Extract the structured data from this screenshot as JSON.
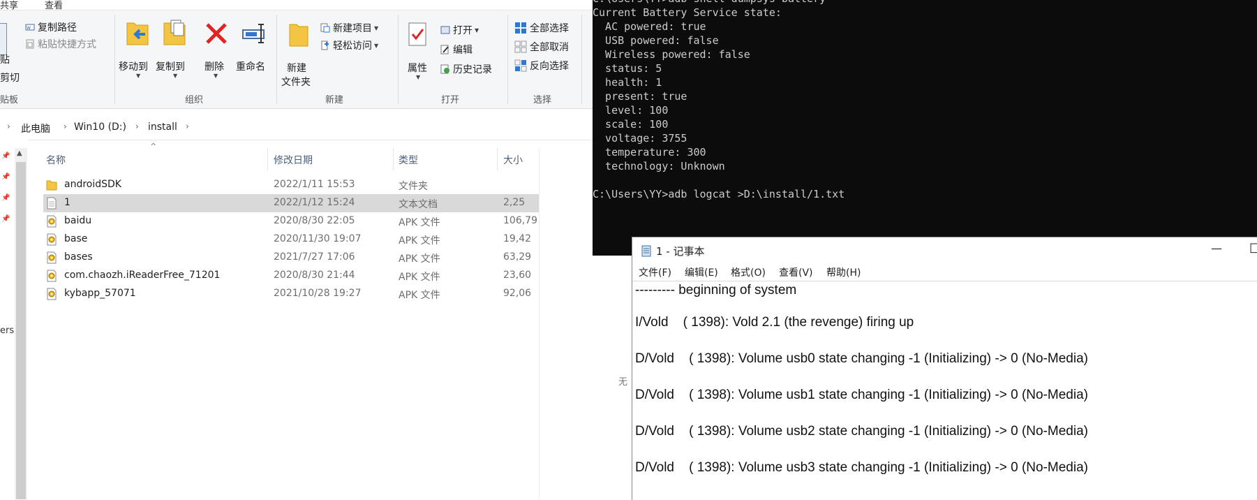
{
  "explorer": {
    "ribbon_tabs": [
      "共享",
      "查看"
    ],
    "clipboard": {
      "group_label": "贴板",
      "paste_label": "贴",
      "cut_label": "剪切",
      "copy_path_label": "复制路径",
      "paste_shortcut_label": "粘贴快捷方式"
    },
    "organize": {
      "group_label": "组织",
      "move_to_label": "移动到",
      "copy_to_label": "复制到",
      "delete_label": "删除",
      "rename_label": "重命名"
    },
    "new": {
      "group_label": "新建",
      "new_folder_label_1": "新建",
      "new_folder_label_2": "文件夹",
      "new_item_label": "新建项目",
      "easy_access_label": "轻松访问"
    },
    "open": {
      "group_label": "打开",
      "properties_label": "属性",
      "open_label": "打开",
      "edit_label": "编辑",
      "history_label": "历史记录"
    },
    "select": {
      "group_label": "选择",
      "select_all_label": "全部选择",
      "select_none_label": "全部取消",
      "invert_label": "反向选择"
    },
    "breadcrumb": [
      "此电脑",
      "Win10 (D:)",
      "install"
    ],
    "columns": {
      "name": "名称",
      "date": "修改日期",
      "type": "类型",
      "size": "大小"
    },
    "files": [
      {
        "name": "androidSDK",
        "date": "2022/1/11 15:53",
        "type": "文件夹",
        "size": "",
        "icon": "folder-icon"
      },
      {
        "name": "1",
        "date": "2022/1/12 15:24",
        "type": "文本文档",
        "size": "2,25",
        "icon": "text-file-icon",
        "selected": true
      },
      {
        "name": "baidu",
        "date": "2020/8/30 22:05",
        "type": "APK 文件",
        "size": "106,79",
        "icon": "apk-file-icon"
      },
      {
        "name": "base",
        "date": "2020/11/30 19:07",
        "type": "APK 文件",
        "size": "19,42",
        "icon": "apk-file-icon"
      },
      {
        "name": "bases",
        "date": "2021/7/27 17:06",
        "type": "APK 文件",
        "size": "63,29",
        "icon": "apk-file-icon"
      },
      {
        "name": "com.chaozh.iReaderFree_71201",
        "date": "2020/8/30 21:44",
        "type": "APK 文件",
        "size": "23,60",
        "icon": "apk-file-icon"
      },
      {
        "name": "kybapp_57071",
        "date": "2021/10/28 19:27",
        "type": "APK 文件",
        "size": "92,06",
        "icon": "apk-file-icon"
      }
    ],
    "nav_fragment": "ers"
  },
  "terminal": {
    "text": "C:\\Users\\YY>adb shell dumpsys battery\nCurrent Battery Service state:\n  AC powered: true\n  USB powered: false\n  Wireless powered: false\n  status: 5\n  health: 1\n  present: true\n  level: 100\n  scale: 100\n  voltage: 3755\n  temperature: 300\n  technology: Unknown\n\nC:\\Users\\YY>adb logcat >D:\\install/1.txt"
  },
  "notepad": {
    "title": "1 - 记事本",
    "menu": [
      "文件(F)",
      "编辑(E)",
      "格式(O)",
      "查看(V)",
      "帮助(H)"
    ],
    "lines": [
      "--------- beginning of system",
      "I/Vold    ( 1398): Vold 2.1 (the revenge) firing up",
      "D/Vold    ( 1398): Volume usb0 state changing -1 (Initializing) -> 0 (No-Media)",
      "D/Vold    ( 1398): Volume usb1 state changing -1 (Initializing) -> 0 (No-Media)",
      "D/Vold    ( 1398): Volume usb2 state changing -1 (Initializing) -> 0 (No-Media)",
      "D/Vold    ( 1398): Volume usb3 state changing -1 (Initializing) -> 0 (No-Media)"
    ],
    "minimize_glyph": "—",
    "maximize_glyph": "□"
  },
  "stray_text": "无"
}
